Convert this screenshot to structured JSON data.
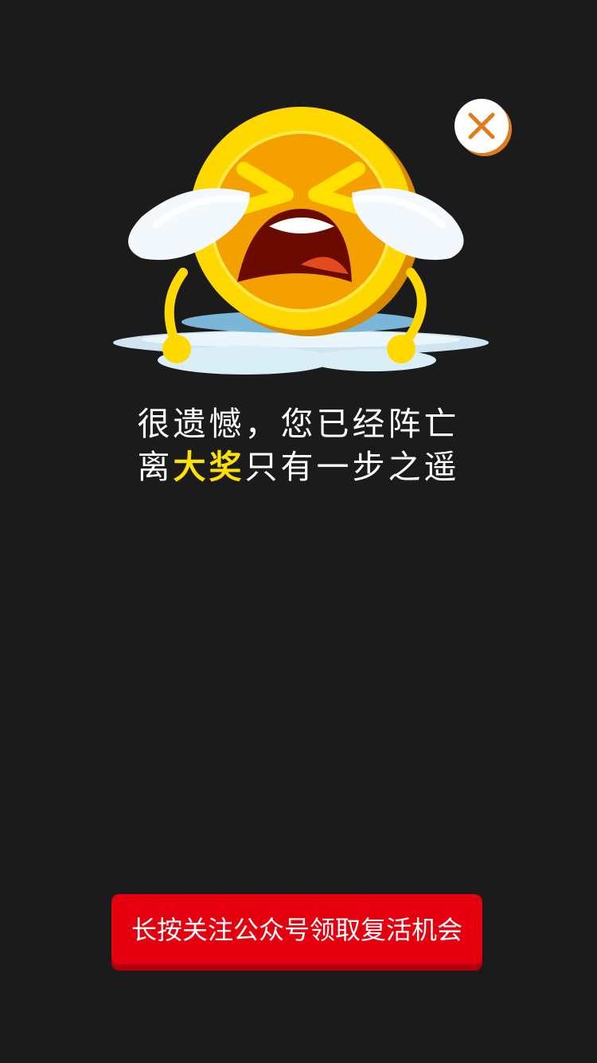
{
  "illustration": {
    "icon": "crying-coin-icon"
  },
  "close": {
    "icon": "close-icon"
  },
  "message": {
    "line1": "很遗憾，您已经阵亡",
    "line2_prefix": "离",
    "line2_highlight": "大奖",
    "line2_suffix": "只有一步之遥"
  },
  "cta": {
    "label": "长按关注公众号领取复活机会"
  },
  "colors": {
    "background": "#1b1b1b",
    "highlight": "#ffe000",
    "button": "#e6000f",
    "close_accent": "#e07c1a"
  }
}
